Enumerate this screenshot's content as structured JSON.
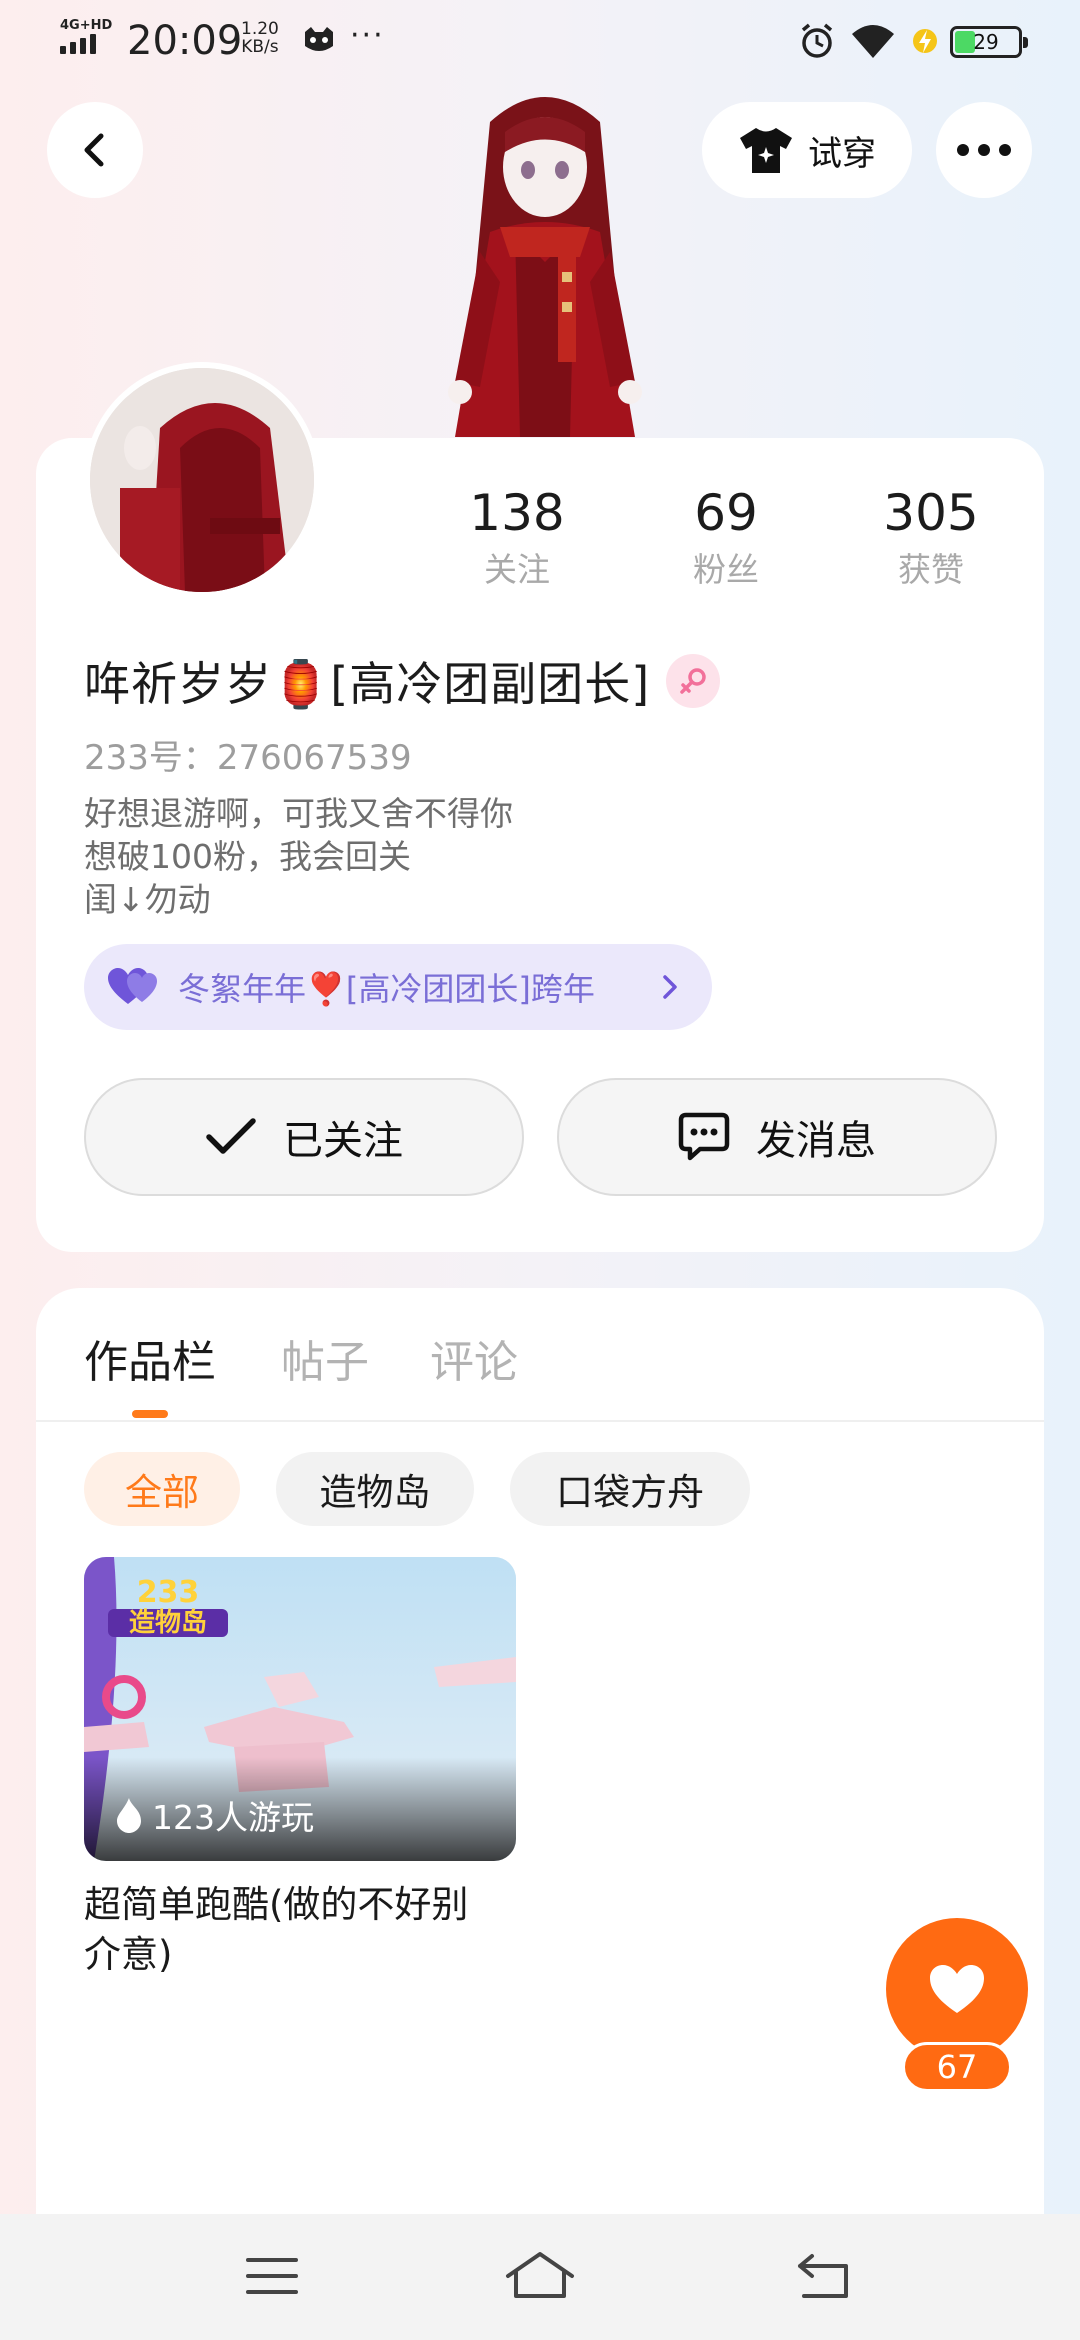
{
  "status_bar": {
    "network": "4G+HD",
    "time": "20:09",
    "speed_value": "1.20",
    "speed_unit": "KB/s",
    "more": "···",
    "battery": "29",
    "icons": [
      "signal-icon",
      "cat-face-icon",
      "alarm-icon",
      "wifi-icon",
      "charging-icon",
      "battery-icon"
    ]
  },
  "top_bar": {
    "back_icon": "chevron-left-icon",
    "try_on_label": "试穿",
    "try_on_icon": "shirt-icon",
    "more_icon": "more-dots-icon"
  },
  "profile": {
    "stats": [
      {
        "value": "138",
        "label": "关注"
      },
      {
        "value": "69",
        "label": "粉丝"
      },
      {
        "value": "305",
        "label": "获赞"
      }
    ],
    "nickname": "哖祈岁岁🏮[高冷团副团长]",
    "gender": "female",
    "uid": "233号：276067539",
    "bio_lines": [
      "好想退游啊，可我又舍不得你",
      "想破100粉，我会回关",
      "闺↓勿动"
    ],
    "title_pill": "冬絮年年❣️[高冷团团长]跨年",
    "follow_label": "已关注",
    "message_label": "发消息"
  },
  "works": {
    "tabs": [
      "作品栏",
      "帖子",
      "评论"
    ],
    "active_tab": 0,
    "filters": [
      "全部",
      "造物岛",
      "口袋方舟"
    ],
    "active_filter": 0,
    "game": {
      "logo_text_top": "233",
      "logo_text_bottom": "造物岛",
      "plays": "123人游玩",
      "title": "超简单跑酷(做的不好别介意)"
    },
    "likes": "67"
  },
  "colors": {
    "accent": "#ff6a12",
    "title_pill_bg": "#ebe8fb",
    "title_pill_text": "#7a6ed6",
    "muted_text": "#9d9d9d"
  },
  "nav": {
    "icons": [
      "menu-icon",
      "home-icon",
      "back-icon"
    ]
  }
}
